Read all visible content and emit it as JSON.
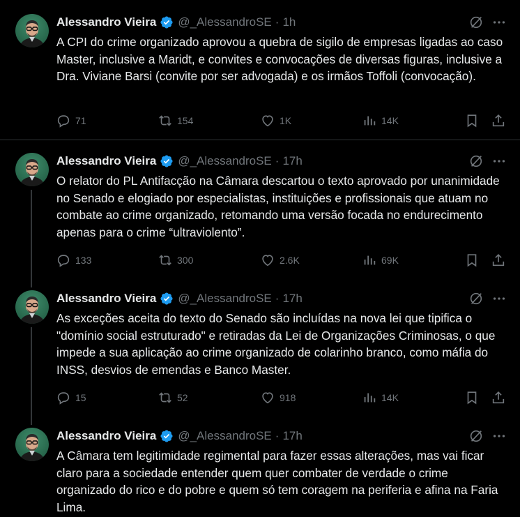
{
  "tweets": [
    {
      "author": "Alessandro Vieira",
      "handle": "@_AlessandroSE",
      "separator": "·",
      "time": "1h",
      "text": "A CPI do crime organizado aprovou a quebra de sigilo de empresas ligadas ao caso Master, inclusive a Maridt, e convites e convocações de diversas figuras, inclusive a Dra. Viviane Barsi (convite por ser advogada) e os irmãos Toffoli (convocação).",
      "replies": "71",
      "reposts": "154",
      "likes": "1K",
      "views": "14K"
    },
    {
      "author": "Alessandro Vieira",
      "handle": "@_AlessandroSE",
      "separator": "·",
      "time": "17h",
      "text": "O relator do PL Antifacção na Câmara descartou o texto aprovado por unanimidade no Senado e elogiado por especialistas, instituições e profissionais que atuam no combate ao crime organizado, retomando uma versão focada no endurecimento apenas para o crime “ultraviolento”.",
      "replies": "133",
      "reposts": "300",
      "likes": "2.6K",
      "views": "69K"
    },
    {
      "author": "Alessandro Vieira",
      "handle": "@_AlessandroSE",
      "separator": "·",
      "time": "17h",
      "text": "As exceções aceita do texto do Senado são incluídas na nova lei que tipifica o \"domínio social estruturado\" e retiradas da Lei de Organizações Criminosas, o que impede a sua aplicação ao crime organizado de colarinho branco, como máfia do INSS, desvios de emendas e Banco Master.",
      "replies": "15",
      "reposts": "52",
      "likes": "918",
      "views": "14K"
    },
    {
      "author": "Alessandro Vieira",
      "handle": "@_AlessandroSE",
      "separator": "·",
      "time": "17h",
      "text": "A Câmara tem legitimidade regimental para fazer essas alterações, mas vai ficar claro para a sociedade entender quem quer combater de verdade o crime organizado do rico e do pobre e quem só tem coragem na periferia e afina na Faria Lima."
    }
  ],
  "icons": {
    "verified": "verified-badge-icon",
    "grok": "grok-icon",
    "more": "more-icon",
    "reply": "reply-icon",
    "repost": "repost-icon",
    "like": "like-icon",
    "views": "views-icon",
    "bookmark": "bookmark-icon",
    "share": "share-icon"
  },
  "colors": {
    "background": "#000000",
    "text": "#e7e9ea",
    "secondary": "#71767b",
    "verified": "#1d9bf0",
    "divider": "#2f3336"
  }
}
